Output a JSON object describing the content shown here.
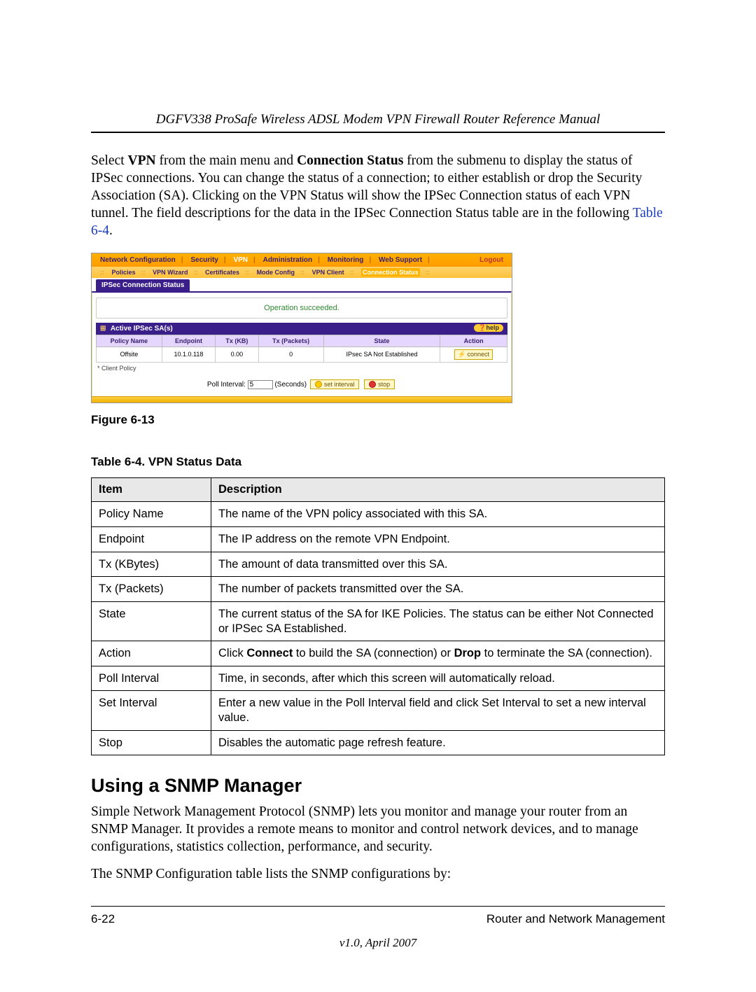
{
  "header": {
    "doc_title": "DGFV338 ProSafe Wireless ADSL Modem VPN Firewall Router Reference Manual"
  },
  "intro": {
    "p1_a": "Select ",
    "p1_b": "VPN",
    "p1_c": " from the main menu and ",
    "p1_d": "Connection Status",
    "p1_e": " from the submenu to display the status of IPSec connections. You can change the status of a connection; to either establish or drop the Security Association (SA). Clicking on the VPN Status will show the IPSec Connection status of each VPN tunnel. The field descriptions for the data in the IPSec Connection Status table are in the following ",
    "p1_link": "Table 6-4",
    "p1_f": "."
  },
  "screenshot": {
    "topnav": {
      "items": [
        "Network Configuration",
        "Security",
        "VPN",
        "Administration",
        "Monitoring",
        "Web Support",
        "Logout"
      ],
      "active": "VPN"
    },
    "subnav": {
      "items": [
        "Policies",
        "VPN Wizard",
        "Certificates",
        "Mode Config",
        "VPN Client",
        "Connection Status"
      ],
      "active": "Connection Status"
    },
    "tab_label": "IPSec Connection Status",
    "status_msg": "Operation succeeded.",
    "section_title": "Active IPSec SA(s)",
    "help_label": "help",
    "columns": [
      "Policy Name",
      "Endpoint",
      "Tx (KB)",
      "Tx (Packets)",
      "State",
      "Action"
    ],
    "row": {
      "policy": "Offsite",
      "endpoint": "10.1.0.118",
      "txkb": "0.00",
      "txpk": "0",
      "state": "IPsec SA Not Established",
      "action": "connect"
    },
    "footnote": "* Client Policy",
    "poll_label": "Poll Interval:",
    "poll_value": "5",
    "poll_unit": "(Seconds)",
    "btn_set": "set interval",
    "btn_stop": "stop"
  },
  "fig_caption": "Figure 6-13",
  "table_caption": "Table 6-4.   VPN Status Data",
  "datatable": {
    "headers": [
      "Item",
      "Description"
    ],
    "rows": [
      {
        "item": "Policy Name",
        "desc": "The name of the VPN policy associated with this SA."
      },
      {
        "item": "Endpoint",
        "desc": "The IP address on the remote VPN Endpoint."
      },
      {
        "item": "Tx (KBytes)",
        "desc": "The amount of data transmitted over this SA."
      },
      {
        "item": "Tx (Packets)",
        "desc": "The number of packets transmitted over the SA."
      },
      {
        "item": "State",
        "desc": "The current status of the SA for IKE Policies. The status can be either Not Connected or IPSec SA Established."
      },
      {
        "item": "Action",
        "desc_pre": "Click ",
        "b1": "Connect",
        "desc_mid": " to build the SA (connection) or ",
        "b2": "Drop",
        "desc_post": " to terminate the SA (connection)."
      },
      {
        "item": "Poll Interval",
        "desc": "Time, in seconds, after which this screen will automatically reload."
      },
      {
        "item": "Set Interval",
        "desc": "Enter a new value in the Poll Interval field and click Set Interval to set a new interval value."
      },
      {
        "item": "Stop",
        "desc": "Disables the automatic page refresh feature."
      }
    ]
  },
  "section_heading": "Using a SNMP Manager",
  "snmp_p1": "Simple Network Management Protocol (SNMP) lets you monitor and manage your router from an SNMP Manager. It provides a remote means to monitor and control network devices, and to manage configurations, statistics collection, performance, and security.",
  "snmp_p2": "The SNMP Configuration table lists the SNMP configurations by:",
  "footer": {
    "page_num": "6-22",
    "chapter": "Router and Network Management",
    "version": "v1.0, April 2007"
  }
}
